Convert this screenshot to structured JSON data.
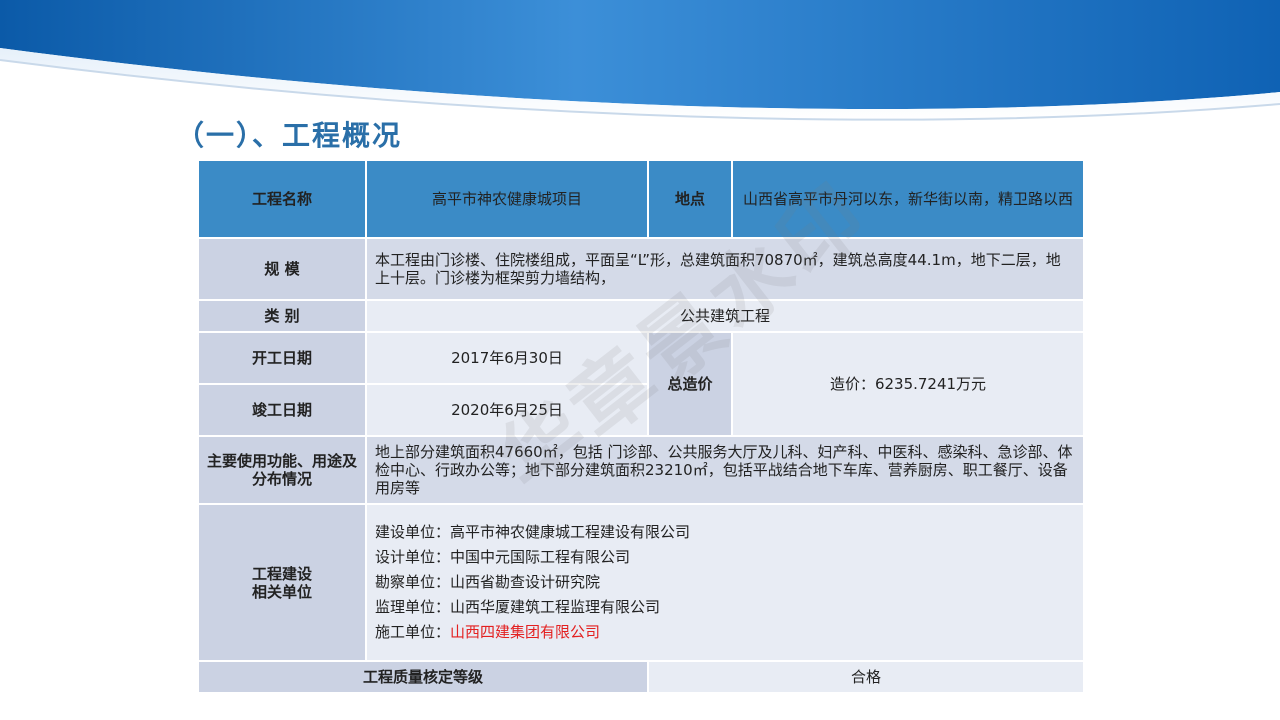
{
  "title": "（一）、工程概况",
  "watermark": "华章景水印",
  "header": {
    "name_label": "工程名称",
    "name_value": "高平市神农健康城项目",
    "location_label": "地点",
    "location_value": "山西省高平市丹河以东，新华街以南，精卫路以西"
  },
  "scale": {
    "label": "规 模",
    "value": "本工程由门诊楼、住院楼组成，平面呈“L”形，总建筑面积70870㎡，建筑总高度44.1m，地下二层，地上十层。门诊楼为框架剪力墙结构，"
  },
  "category": {
    "label": "类 别",
    "value": "公共建筑工程"
  },
  "dates": {
    "start_label": "开工日期",
    "start_value": "2017年6月30日",
    "end_label": "竣工日期",
    "end_value": "2020年6月25日"
  },
  "cost": {
    "label": "总造价",
    "value": "造价：6235.7241万元"
  },
  "function": {
    "label": "主要使用功能、用途及分布情况",
    "value": "地上部分建筑面积47660㎡，包括 门诊部、公共服务大厅及儿科、妇产科、中医科、感染科、急诊部、体检中心、行政办公等；地下部分建筑面积23210㎡，包括平战结合地下车库、营养厨房、职工餐厅、设备用房等"
  },
  "units": {
    "label_line1": "工程建设",
    "label_line2": "相关单位",
    "items": [
      {
        "role": "建设单位：",
        "name": "高平市神农健康城工程建设有限公司"
      },
      {
        "role": "设计单位：",
        "name": "中国中元国际工程有限公司"
      },
      {
        "role": "勘察单位：",
        "name": "山西省勘查设计研究院"
      },
      {
        "role": "监理单位：",
        "name": "山西华厦建筑工程监理有限公司"
      },
      {
        "role": "施工单位：",
        "name": "山西四建集团有限公司"
      }
    ]
  },
  "quality": {
    "label": "工程质量核定等级",
    "value": "合格"
  },
  "colors": {
    "header_bg": "#3b8bc6",
    "label_bg": "#cbd2e3",
    "value_bg": "#e8ecf4",
    "title_color": "#2a6fa8",
    "highlight_red": "#e32020"
  }
}
